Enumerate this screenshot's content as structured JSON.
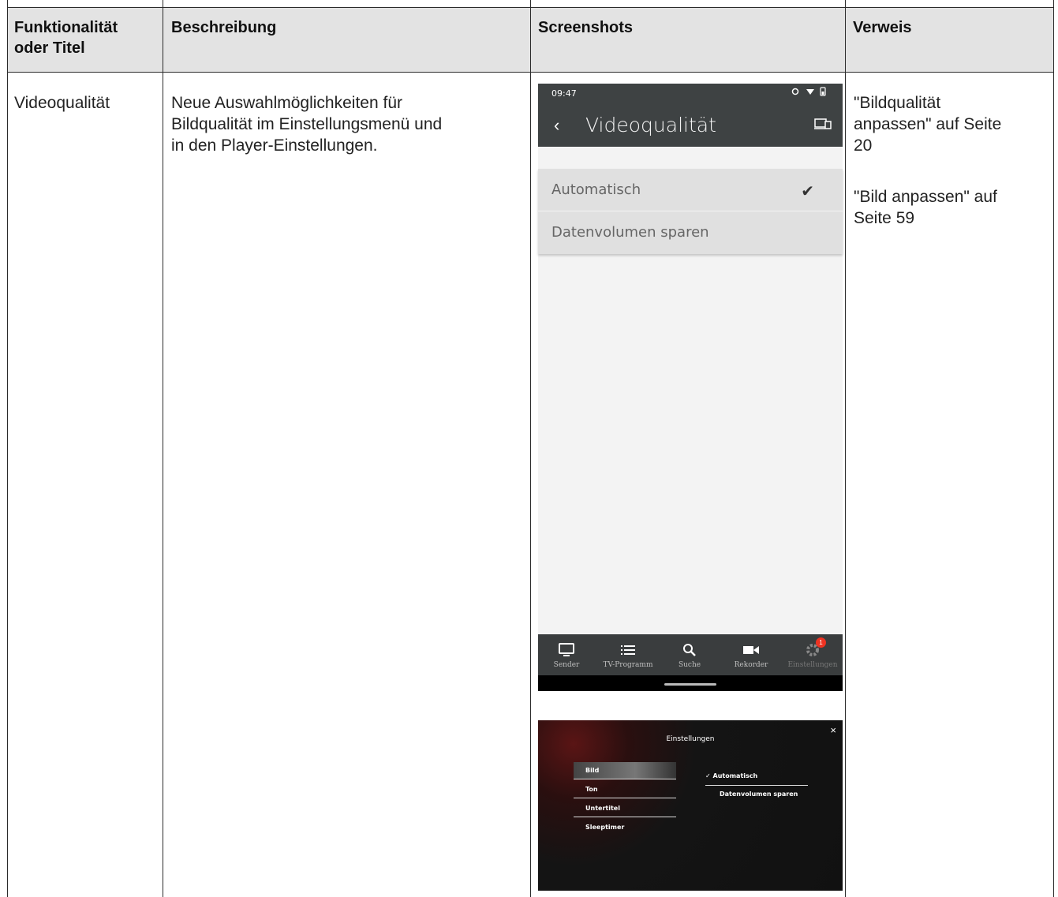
{
  "table": {
    "headers": [
      "Funktionalität oder Titel",
      "Beschreibung",
      "Screenshots",
      "Verweis"
    ],
    "header_lines": {
      "col1_line1": "Funktionalität",
      "col1_line2": "oder Titel"
    },
    "row": {
      "title": "Videoqualität",
      "description_lines": [
        "Neue Auswahlmöglichkeiten für",
        "Bildqualität im Einstellungsmenü und",
        "in den Player-Einstellungen."
      ],
      "reference_1_lines": [
        "\"Bildqualität",
        "anpassen\" auf Seite",
        "20"
      ],
      "reference_2_lines": [
        "\"Bild anpassen\" auf",
        "Seite 59"
      ]
    }
  },
  "phone": {
    "time": "09:47",
    "screen_title": "Videoqualität",
    "options": [
      "Automatisch",
      "Datenvolumen sparen"
    ],
    "selected_option": "Automatisch",
    "nav": [
      {
        "label": "Sender",
        "icon": "tv-icon"
      },
      {
        "label": "TV-Programm",
        "icon": "list-icon"
      },
      {
        "label": "Suche",
        "icon": "search-icon"
      },
      {
        "label": "Rekorder",
        "icon": "camera-icon"
      },
      {
        "label": "Einstellungen",
        "icon": "gear-icon"
      }
    ],
    "badge_count": "1"
  },
  "player": {
    "title": "Einstellungen",
    "menu": [
      "Bild",
      "Ton",
      "Untertitel",
      "Sleeptimer"
    ],
    "options": [
      "Automatisch",
      "Datenvolumen sparen"
    ],
    "check": "✓",
    "close": "×"
  }
}
